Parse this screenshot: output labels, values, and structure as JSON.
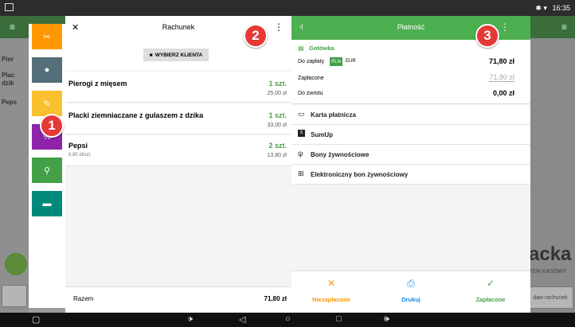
{
  "status_bar": {
    "time": "16:35",
    "icons": "✱ ▾"
  },
  "nav_bar": {
    "back": "◁",
    "home": "○",
    "recent": "□",
    "screenshot": "▢",
    "vol_down": "🕩",
    "vol_up": "🕪"
  },
  "background": {
    "left_labels": [
      "Pier",
      "Plac",
      "dzik",
      "Peps"
    ],
    "brand": "acka",
    "brand_sub": "TEM KASOWY",
    "right_button": "daw rachunek"
  },
  "menu_tiles": [
    {
      "icon": "fork-icon",
      "glyph": "✂",
      "color": "#ff9800"
    },
    {
      "icon": "person-icon",
      "glyph": "👤",
      "color": "#546e7a"
    },
    {
      "icon": "pen-icon",
      "glyph": "✎",
      "color": "#fbc02d"
    },
    {
      "icon": "percent-icon",
      "glyph": "%",
      "color": "#8e24aa"
    },
    {
      "icon": "walker-icon",
      "glyph": "⚲",
      "color": "#43a047"
    },
    {
      "icon": "car-icon",
      "glyph": "▰",
      "color": "#00897b"
    }
  ],
  "bill": {
    "title": "Rachunek",
    "close": "✕",
    "more": "⋮",
    "client_button": "WYBIERZ KLIENTA",
    "items": [
      {
        "name": "Pierogi z mięsem",
        "qty": "1 szt.",
        "price": "25,00 zł",
        "unit": ""
      },
      {
        "name": "Placki ziemniaczane z gulaszem z dzika",
        "qty": "1 szt.",
        "price": "33,00 zł",
        "unit": ""
      },
      {
        "name": "Pepsi",
        "qty": "2 szt.",
        "price": "13,80 zł",
        "unit": "6,90 zł/szt."
      }
    ],
    "total_label": "Razem",
    "total_value": "71,80 zł"
  },
  "payment": {
    "title": "Płatność",
    "collapse": "›|",
    "more": "⋮",
    "cash_label": "Gotówka",
    "due_label": "Do zapłaty",
    "currency_pln": "PLN",
    "currency_eur": "EUR",
    "due_value": "71,80 zł",
    "paid_label": "Zapłacone",
    "paid_placeholder": "71,80 zł",
    "change_label": "Do zwrotu",
    "change_value": "0,00 zł",
    "methods": [
      "Karta płatnicza",
      "SumUp",
      "Bony żywnościowe",
      "Elektroniczny bon żywnościowy"
    ],
    "actions": {
      "unpaid": "Niezapłacone",
      "print": "Drukuj",
      "paid": "Zapłacone"
    },
    "accent": "#4caf50",
    "warn": "#ff9800",
    "info": "#1e88e5"
  },
  "badges": [
    "1",
    "2",
    "3"
  ]
}
